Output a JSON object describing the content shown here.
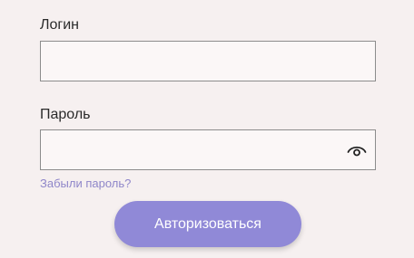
{
  "form": {
    "login": {
      "label": "Логин",
      "value": "",
      "placeholder": ""
    },
    "password": {
      "label": "Пароль",
      "value": "",
      "placeholder": "",
      "toggle_icon": "eye-icon"
    },
    "forgot_password_label": "Забыли пароль?",
    "submit_label": "Авторизоваться"
  },
  "colors": {
    "background": "#f6f0f0",
    "input_border": "#8c8c8c",
    "link": "#8f86c9",
    "button": "#9089d7",
    "button_text": "#ffffff"
  }
}
